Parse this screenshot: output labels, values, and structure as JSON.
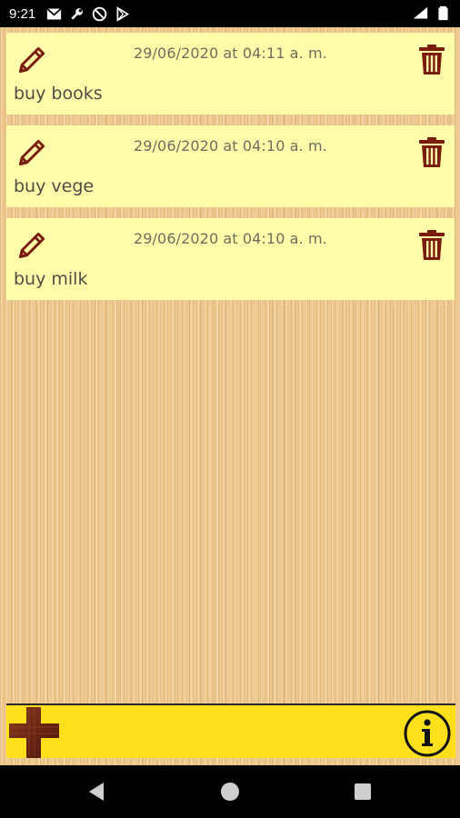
{
  "status_bar": {
    "time": "9:21",
    "left_icons": [
      "gmail-icon",
      "wrench-notification-icon",
      "no-signal-icon",
      "play-store-icon"
    ],
    "right_icons": [
      "wifi-icon",
      "battery-icon"
    ]
  },
  "notes": [
    {
      "date": "29/06/2020 at 04:11 a. m.",
      "text": "buy books"
    },
    {
      "date": "29/06/2020 at 04:10 a. m.",
      "text": "buy vege"
    },
    {
      "date": "29/06/2020 at 04:10 a. m.",
      "text": "buy milk"
    }
  ],
  "icons": {
    "edit": "pencil-icon",
    "delete": "trash-icon",
    "add": "plus-icon",
    "info": "info-icon"
  },
  "colors": {
    "note_background": "#fffcaa",
    "bottom_bar": "#ffe01a",
    "icon_brown": "#7a1c0c",
    "wood": "#eec990"
  },
  "nav_bar": {
    "buttons": [
      "back-icon",
      "home-icon",
      "recents-icon"
    ]
  }
}
